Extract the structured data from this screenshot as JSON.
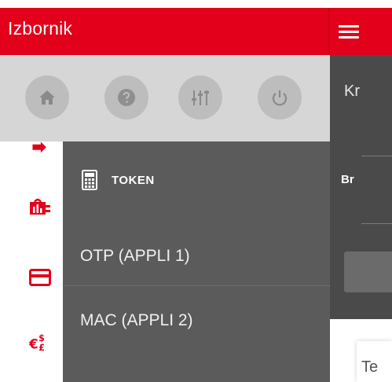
{
  "header": {
    "title": "Izbornik"
  },
  "quick_actions": [
    {
      "icon": "home-icon"
    },
    {
      "icon": "help-icon"
    },
    {
      "icon": "settings-sliders-icon"
    },
    {
      "icon": "power-icon"
    }
  ],
  "drawer": {
    "section_title": "TOKEN",
    "section_icon": "calculator-icon",
    "items": [
      {
        "label": "OTP (APPLI 1)"
      },
      {
        "label": "MAC (APPLI 2)"
      }
    ]
  },
  "side_icons": [
    "transfer-icon",
    "statistics-icon",
    "card-icon",
    "currency-exchange-icon"
  ],
  "background": {
    "text_top": "Kr",
    "text_mid": "Br",
    "text_bottom": "Te"
  },
  "colors": {
    "brand_red": "#e2001a",
    "drawer_gray": "#5b5b5b",
    "icon_bar_gray": "#d6d6d6"
  }
}
